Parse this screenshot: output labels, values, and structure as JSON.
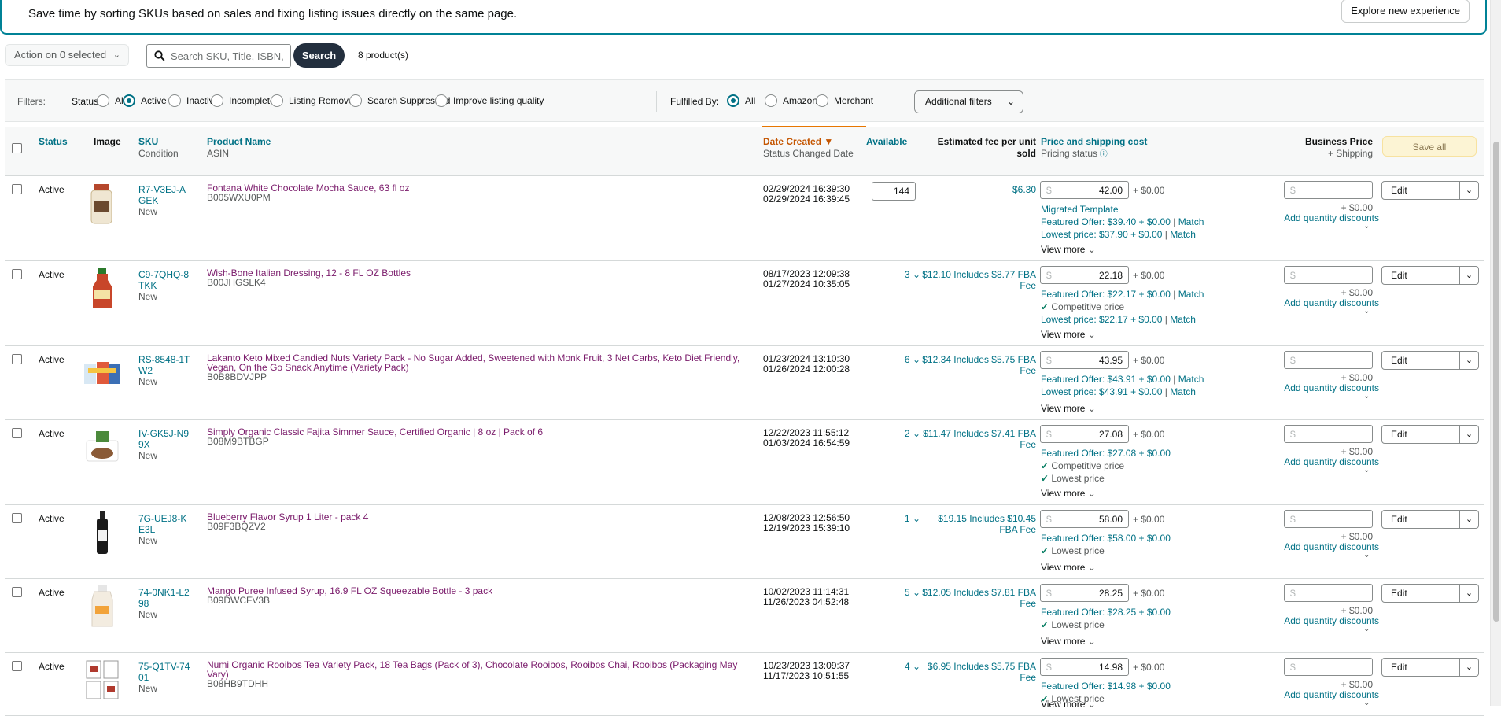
{
  "banner": {
    "message": "Save time by sorting SKUs based on sales and fixing listing issues directly on the same page.",
    "explore_label": "Explore new experience"
  },
  "toolbar": {
    "action_label": "Action on 0 selected",
    "search_placeholder": "Search SKU, Title, ISBN,",
    "search_label": "Search",
    "product_count": "8 product(s)"
  },
  "filters": {
    "label": "Filters:",
    "status_label": "Status:",
    "status_options": [
      {
        "label": "All",
        "selected": false
      },
      {
        "label": "Active",
        "selected": true
      },
      {
        "label": "Inactive",
        "selected": false
      },
      {
        "label": "Incomplete",
        "selected": false
      },
      {
        "label": "Listing Removed",
        "selected": false
      },
      {
        "label": "Search Suppressed",
        "selected": false
      },
      {
        "label": "Improve listing quality",
        "selected": false
      }
    ],
    "fulfilled_label": "Fulfilled By:",
    "fulfilled_options": [
      {
        "label": "All",
        "selected": true
      },
      {
        "label": "Amazon",
        "selected": false
      },
      {
        "label": "Merchant",
        "selected": false
      }
    ],
    "additional_label": "Additional filters"
  },
  "columns": {
    "status": "Status",
    "image": "Image",
    "sku": "SKU",
    "condition": "Condition",
    "product_name": "Product Name",
    "asin": "ASIN",
    "date_created": "Date Created",
    "status_changed": "Status Changed Date",
    "available": "Available",
    "fee_line1": "Estimated fee per unit",
    "fee_line2": "sold",
    "price": "Price and shipping cost",
    "pricing_status": "Pricing status",
    "business_price": "Business Price",
    "plus_shipping": "+ Shipping",
    "save_all": "Save all"
  },
  "common": {
    "ship_add": "+ $0.00",
    "currency": "$",
    "view_more": "View more",
    "qty_discounts": "Add quantity discounts",
    "edit": "Edit",
    "match": "Match"
  },
  "rows": [
    {
      "status": "Active",
      "sku": "R7-V3EJ-AGEK",
      "condition": "New",
      "name": "Fontana White Chocolate Mocha Sauce, 63 fl oz",
      "asin": "B005WXU0PM",
      "created": "02/29/2024 16:39:30",
      "changed": "02/29/2024 16:39:45",
      "available": "144",
      "fee": "$6.30",
      "price": "42.00",
      "offers": [
        {
          "text": "Migrated Template",
          "type": "link"
        },
        {
          "text": "Featured Offer: $39.40 + $0.00",
          "type": "match"
        },
        {
          "text": "Lowest price: $37.90 + $0.00",
          "type": "match"
        }
      ]
    },
    {
      "status": "Active",
      "sku": "C9-7QHQ-8TKK",
      "condition": "New",
      "name": "Wish-Bone Italian Dressing, 12 - 8 FL OZ Bottles",
      "asin": "B00JHGSLK4",
      "created": "08/17/2023 12:09:38",
      "changed": "01/27/2024 10:35:05",
      "available": "3",
      "fee": "$12.10 Includes $8.77 FBA Fee",
      "price": "22.18",
      "offers": [
        {
          "text": "Featured Offer: $22.17 + $0.00",
          "type": "match"
        },
        {
          "text": "Competitive price",
          "type": "check"
        },
        {
          "text": "Lowest price: $22.17 + $0.00",
          "type": "match"
        }
      ]
    },
    {
      "status": "Active",
      "sku": "RS-8548-1TW2",
      "condition": "New",
      "name": "Lakanto Keto Mixed Candied Nuts Variety Pack - No Sugar Added, Sweetened with Monk Fruit, 3 Net Carbs, Keto Diet Friendly, Vegan, On the Go Snack Anytime (Variety Pack)",
      "asin": "B0B8BDVJPP",
      "created": "01/23/2024 13:10:30",
      "changed": "01/26/2024 12:00:28",
      "available": "6",
      "fee": "$12.34 Includes $5.75 FBA Fee",
      "price": "43.95",
      "offers": [
        {
          "text": "Featured Offer: $43.91 + $0.00",
          "type": "match"
        },
        {
          "text": "Lowest price: $43.91 + $0.00",
          "type": "match"
        }
      ]
    },
    {
      "status": "Active",
      "sku": "IV-GK5J-N99X",
      "condition": "New",
      "name": "Simply Organic Classic Fajita Simmer Sauce, Certified Organic | 8 oz | Pack of 6",
      "asin": "B08M9BTBGP",
      "created": "12/22/2023 11:55:12",
      "changed": "01/03/2024 16:54:59",
      "available": "2",
      "fee": "$11.47 Includes $7.41 FBA Fee",
      "price": "27.08",
      "offers": [
        {
          "text": "Featured Offer: $27.08 + $0.00",
          "type": "plain"
        },
        {
          "text": "Competitive price",
          "type": "check"
        },
        {
          "text": "Lowest price",
          "type": "check"
        }
      ]
    },
    {
      "status": "Active",
      "sku": "7G-UEJ8-KE3L",
      "condition": "New",
      "name": "Blueberry Flavor Syrup 1 Liter - pack 4",
      "asin": "B09F3BQZV2",
      "created": "12/08/2023 12:56:50",
      "changed": "12/19/2023 15:39:10",
      "available": "1",
      "fee": "$19.15 Includes $10.45 FBA Fee",
      "price": "58.00",
      "offers": [
        {
          "text": "Featured Offer: $58.00 + $0.00",
          "type": "plain"
        },
        {
          "text": "Lowest price",
          "type": "check"
        }
      ]
    },
    {
      "status": "Active",
      "sku": "74-0NK1-L298",
      "condition": "New",
      "name": "Mango Puree Infused Syrup, 16.9 FL OZ Squeezable Bottle - 3 pack",
      "asin": "B09DWCFV3B",
      "created": "10/02/2023 11:14:31",
      "changed": "11/26/2023 04:52:48",
      "available": "5",
      "fee": "$12.05 Includes $7.81 FBA Fee",
      "price": "28.25",
      "offers": [
        {
          "text": "Featured Offer: $28.25 + $0.00",
          "type": "plain"
        },
        {
          "text": "Lowest price",
          "type": "check"
        }
      ]
    },
    {
      "status": "Active",
      "sku": "75-Q1TV-7401",
      "condition": "New",
      "name": "Numi Organic Rooibos Tea Variety Pack, 18 Tea Bags (Pack of 3), Chocolate Rooibos, Rooibos Chai, Rooibos (Packaging May Vary)",
      "asin": "B08HB9TDHH",
      "created": "10/23/2023 13:09:37",
      "changed": "11/17/2023 10:51:55",
      "available": "4",
      "fee": "$6.95 Includes $5.75 FBA Fee",
      "price": "14.98",
      "offers": [
        {
          "text": "Featured Offer: $14.98 + $0.00",
          "type": "plain"
        },
        {
          "text": "Lowest price",
          "type": "check"
        }
      ]
    }
  ]
}
